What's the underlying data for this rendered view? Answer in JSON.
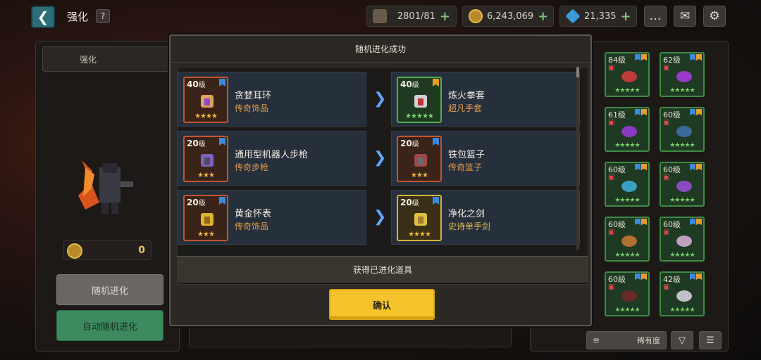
{
  "header": {
    "title": "强化",
    "help_label": "?",
    "stamina": "2801/81",
    "gold": "6,243,069",
    "gems": "21,335",
    "plus_label": "+"
  },
  "left_panel": {
    "tab_label": "强化",
    "coin_count": "0",
    "random_evolve_label": "随机进化",
    "auto_evolve_label": "自动随机进化"
  },
  "modal": {
    "title": "随机进化成功",
    "obtained_label": "获得已进化道具",
    "confirm_label": "确认",
    "rows": [
      {
        "from": {
          "level": "40",
          "unit": "级",
          "name": "贪婪耳环",
          "type": "传奇饰品",
          "stars": "★★★★",
          "rarity": "legend"
        },
        "to": {
          "level": "40",
          "unit": "级",
          "name": "炼火拳套",
          "type": "超凡手套",
          "stars": "★★★★★",
          "rarity": "mythic"
        }
      },
      {
        "from": {
          "level": "20",
          "unit": "级",
          "name": "通用型机器人步枪",
          "type": "传奇步枪",
          "stars": "★★★",
          "rarity": "legend"
        },
        "to": {
          "level": "20",
          "unit": "级",
          "name": "铁包篮子",
          "type": "传奇篮子",
          "stars": "★★★",
          "rarity": "legend"
        }
      },
      {
        "from": {
          "level": "20",
          "unit": "级",
          "name": "黄金怀表",
          "type": "传奇饰品",
          "stars": "★★★",
          "rarity": "legend"
        },
        "to": {
          "level": "20",
          "unit": "级",
          "name": "净化之剑",
          "type": "史诗单手剑",
          "stars": "★★★★",
          "rarity": "epic"
        }
      }
    ]
  },
  "inventory": {
    "items": [
      {
        "level": "84",
        "unit": "级",
        "stars": "★★★★★",
        "locked": true
      },
      {
        "level": "62",
        "unit": "级",
        "stars": "★★★★★",
        "locked": true
      },
      {
        "level": "61",
        "unit": "级",
        "stars": "★★★★★",
        "locked": true
      },
      {
        "level": "60",
        "unit": "级",
        "stars": "★★★★★",
        "locked": true
      },
      {
        "level": "60",
        "unit": "级",
        "stars": "★★★★★",
        "locked": true
      },
      {
        "level": "60",
        "unit": "级",
        "stars": "★★★★★",
        "locked": true
      },
      {
        "level": "60",
        "unit": "级",
        "stars": "★★★★★",
        "locked": true
      },
      {
        "level": "60",
        "unit": "级",
        "stars": "★★★★★",
        "locked": true
      },
      {
        "level": "60",
        "unit": "级",
        "stars": "★★★★★",
        "locked": true
      },
      {
        "level": "42",
        "unit": "级",
        "stars": "★★★★★",
        "locked": true
      }
    ],
    "sort_label": "稀有度"
  },
  "colors": {
    "legend_border": "#c4562e",
    "epic_border": "#d9b339",
    "mythic_border": "#52b04c",
    "confirm_yellow": "#f5c32a",
    "arrow_blue": "#5fa6ff"
  }
}
